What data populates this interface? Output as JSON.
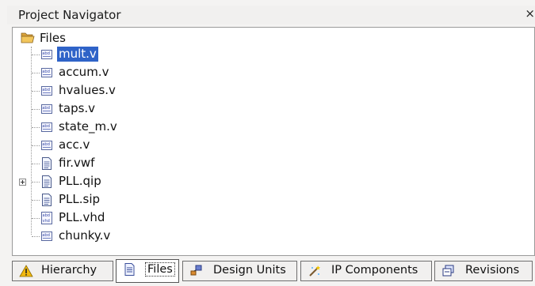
{
  "panel": {
    "title": "Project Navigator",
    "close_glyph": "×"
  },
  "tree": {
    "root": {
      "label": "Files",
      "icon": "folder-open-icon"
    },
    "items": [
      {
        "label": "mult.v",
        "icon": "verilog-file-icon",
        "selected": true
      },
      {
        "label": "accum.v",
        "icon": "verilog-file-icon"
      },
      {
        "label": "hvalues.v",
        "icon": "verilog-file-icon"
      },
      {
        "label": "taps.v",
        "icon": "verilog-file-icon"
      },
      {
        "label": "state_m.v",
        "icon": "verilog-file-icon"
      },
      {
        "label": "acc.v",
        "icon": "verilog-file-icon"
      },
      {
        "label": "fir.vwf",
        "icon": "document-icon"
      },
      {
        "label": "PLL.qip",
        "icon": "document-icon",
        "expandable": true
      },
      {
        "label": "PLL.sip",
        "icon": "document-icon"
      },
      {
        "label": "PLL.vhd",
        "icon": "vhdl-file-icon"
      },
      {
        "label": "chunky.v",
        "icon": "verilog-file-icon"
      }
    ]
  },
  "tabs": [
    {
      "label": "Hierarchy",
      "icon": "warning-triangle-icon"
    },
    {
      "label": "Files",
      "icon": "document-icon",
      "active": true
    },
    {
      "label": "Design Units",
      "icon": "design-units-icon"
    },
    {
      "label": "IP Components",
      "icon": "ip-components-icon"
    },
    {
      "label": "Revisions",
      "icon": "revisions-icon"
    }
  ],
  "colors": {
    "selection": "#2f63c8",
    "folder": "#e8b84a",
    "warning": "#f2b90f"
  }
}
